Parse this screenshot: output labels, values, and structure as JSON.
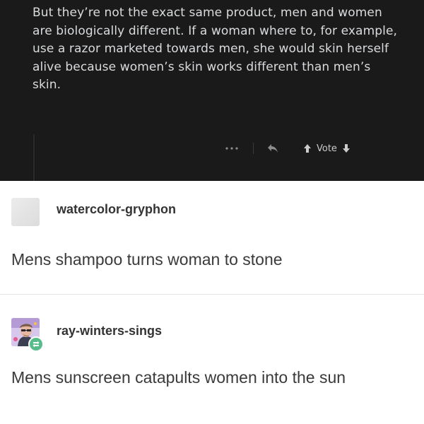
{
  "top_comment": {
    "text": "But they’re not the exact same product, men and women are biologically different. If a woman where to, for example, use a razor marketed towards men, she would skin herself alive because women’s skin works different than men’s skin.",
    "actions": {
      "more_icon": "ellipsis-icon",
      "reply_icon": "reply-icon",
      "vote_label": "Vote",
      "upvote_icon": "upvote-arrow-icon",
      "downvote_icon": "downvote-arrow-icon"
    }
  },
  "replies": [
    {
      "username": "watercolor-gryphon",
      "text": "Mens shampoo turns woman to stone",
      "avatar": "blank-avatar"
    },
    {
      "username": "ray-winters-sings",
      "text": "Mens sunscreen catapults women into the sun",
      "avatar": "illustrated-avatar",
      "badge_icon": "reblog-icon"
    }
  ],
  "colors": {
    "dark_background": "#1a1a1b",
    "dark_text": "#d9dbdd",
    "muted_icon": "#8a8c8e",
    "light_background": "#ffffff",
    "username_text": "#333333",
    "body_text": "#3a3a3a",
    "badge_green": "#56bc8a"
  }
}
